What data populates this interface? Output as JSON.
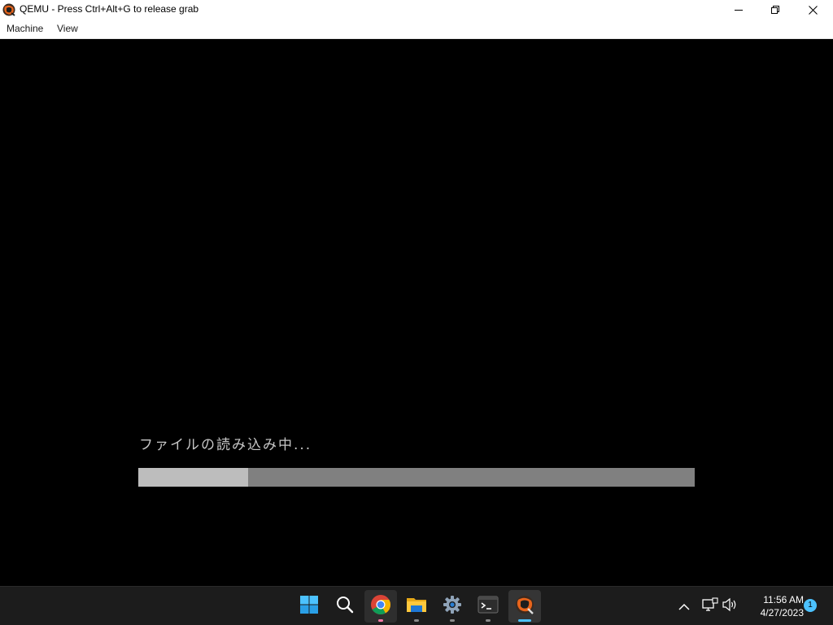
{
  "window": {
    "title": "QEMU - Press Ctrl+Alt+G to release grab",
    "app_icon": "qemu-icon",
    "controls": [
      "minimize-icon",
      "restore-icon",
      "close-icon"
    ]
  },
  "menubar": {
    "items": [
      {
        "label": "Machine"
      },
      {
        "label": "View"
      }
    ]
  },
  "vm": {
    "loading_text": "ファイルの読み込み中...",
    "progress": 0.197,
    "colors": {
      "track": "#808080",
      "fill": "#bdbdbd",
      "text": "#c7c7c7"
    }
  },
  "taskbar": {
    "apps": [
      {
        "name": "start",
        "icon": "windows-start-icon"
      },
      {
        "name": "search",
        "icon": "search-icon"
      },
      {
        "name": "chrome",
        "icon": "chrome-icon",
        "running": true,
        "active": true
      },
      {
        "name": "file-explorer",
        "icon": "folder-icon",
        "running": true
      },
      {
        "name": "settings",
        "icon": "gear-icon",
        "running": true
      },
      {
        "name": "terminal",
        "icon": "terminal-icon",
        "running": true
      },
      {
        "name": "qemu",
        "icon": "qemu-icon",
        "running": true,
        "focused": true
      }
    ],
    "tray": {
      "icons": [
        "chevron-up-icon",
        "network-icon",
        "volume-icon"
      ],
      "time": "11:56 AM",
      "date": "4/27/2023",
      "notification_count": "1"
    },
    "accent": "#4cc2ff"
  }
}
